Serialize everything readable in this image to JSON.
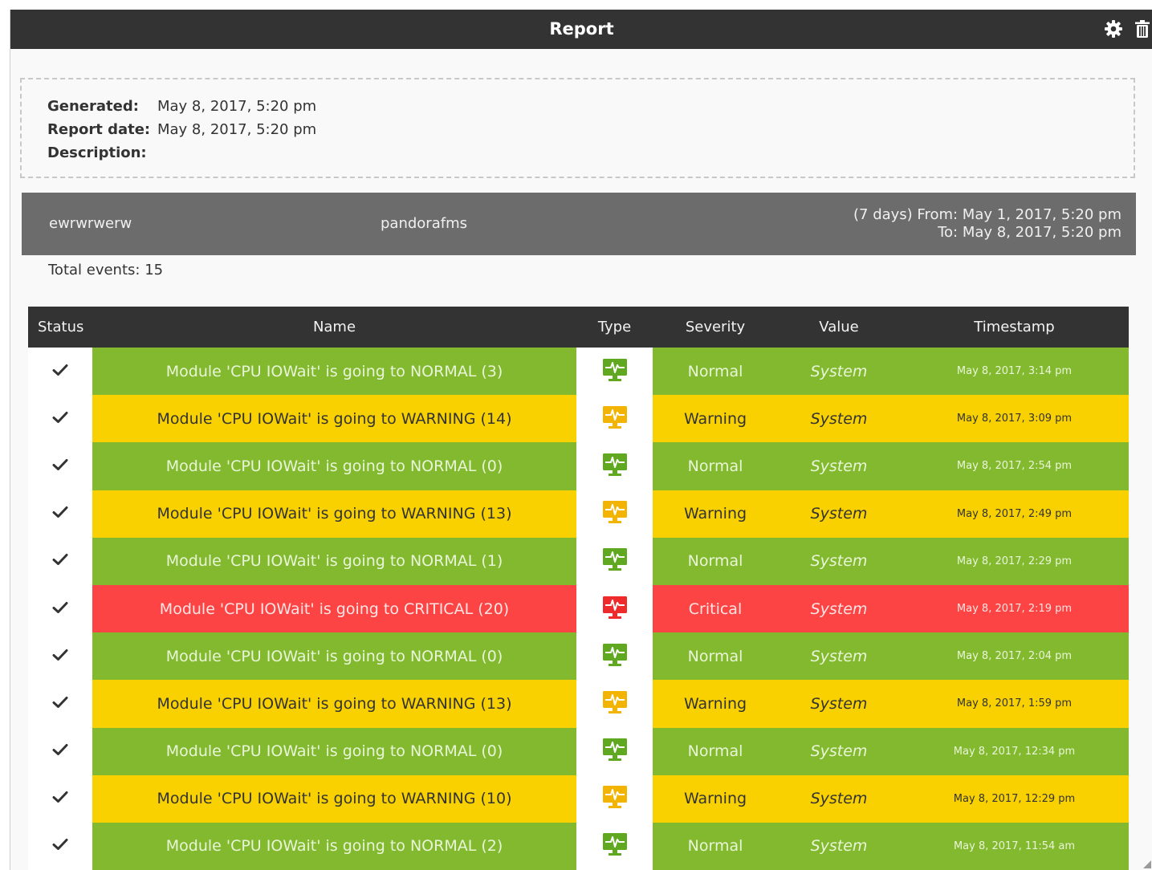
{
  "window": {
    "title": "Report"
  },
  "meta": {
    "generated_label": "Generated:",
    "generated_value": "May 8, 2017, 5:20 pm",
    "report_date_label": "Report date:",
    "report_date_value": "May 8, 2017, 5:20 pm",
    "description_label": "Description:",
    "description_value": ""
  },
  "band": {
    "agent": "ewrwrwerw",
    "group": "pandorafms",
    "from_text": "(7 days) From: May 1, 2017, 5:20 pm",
    "to_text": "To: May 8, 2017, 5:20 pm"
  },
  "total_events": "Total events: 15",
  "table": {
    "headers": {
      "status": "Status",
      "name": "Name",
      "type": "Type",
      "severity": "Severity",
      "value": "Value",
      "timestamp": "Timestamp"
    },
    "rows": [
      {
        "name": "Module 'CPU IOWait' is going to NORMAL (3)",
        "severity": "Normal",
        "value": "System",
        "timestamp": "May 8, 2017, 3:14 pm"
      },
      {
        "name": "Module 'CPU IOWait' is going to WARNING (14)",
        "severity": "Warning",
        "value": "System",
        "timestamp": "May 8, 2017, 3:09 pm"
      },
      {
        "name": "Module 'CPU IOWait' is going to NORMAL (0)",
        "severity": "Normal",
        "value": "System",
        "timestamp": "May 8, 2017, 2:54 pm"
      },
      {
        "name": "Module 'CPU IOWait' is going to WARNING (13)",
        "severity": "Warning",
        "value": "System",
        "timestamp": "May 8, 2017, 2:49 pm"
      },
      {
        "name": "Module 'CPU IOWait' is going to NORMAL (1)",
        "severity": "Normal",
        "value": "System",
        "timestamp": "May 8, 2017, 2:29 pm"
      },
      {
        "name": "Module 'CPU IOWait' is going to CRITICAL (20)",
        "severity": "Critical",
        "value": "System",
        "timestamp": "May 8, 2017, 2:19 pm"
      },
      {
        "name": "Module 'CPU IOWait' is going to NORMAL (0)",
        "severity": "Normal",
        "value": "System",
        "timestamp": "May 8, 2017, 2:04 pm"
      },
      {
        "name": "Module 'CPU IOWait' is going to WARNING (13)",
        "severity": "Warning",
        "value": "System",
        "timestamp": "May 8, 2017, 1:59 pm"
      },
      {
        "name": "Module 'CPU IOWait' is going to NORMAL (0)",
        "severity": "Normal",
        "value": "System",
        "timestamp": "May 8, 2017, 12:34 pm"
      },
      {
        "name": "Module 'CPU IOWait' is going to WARNING (10)",
        "severity": "Warning",
        "value": "System",
        "timestamp": "May 8, 2017, 12:29 pm"
      },
      {
        "name": "Module 'CPU IOWait' is going to NORMAL (2)",
        "severity": "Normal",
        "value": "System",
        "timestamp": "May 8, 2017, 11:54 am"
      }
    ]
  },
  "icons": {
    "settings": "gear-icon",
    "delete": "trash-icon",
    "status": "checkmark-icon",
    "type": "monitor-heartbeat-icon"
  },
  "colors": {
    "normal": "#82b92e",
    "warning": "#f9d100",
    "critical": "#fc4444",
    "normal_icon": "#5fa81f",
    "warning_icon": "#f2b400",
    "critical_icon": "#ef2a2a"
  }
}
